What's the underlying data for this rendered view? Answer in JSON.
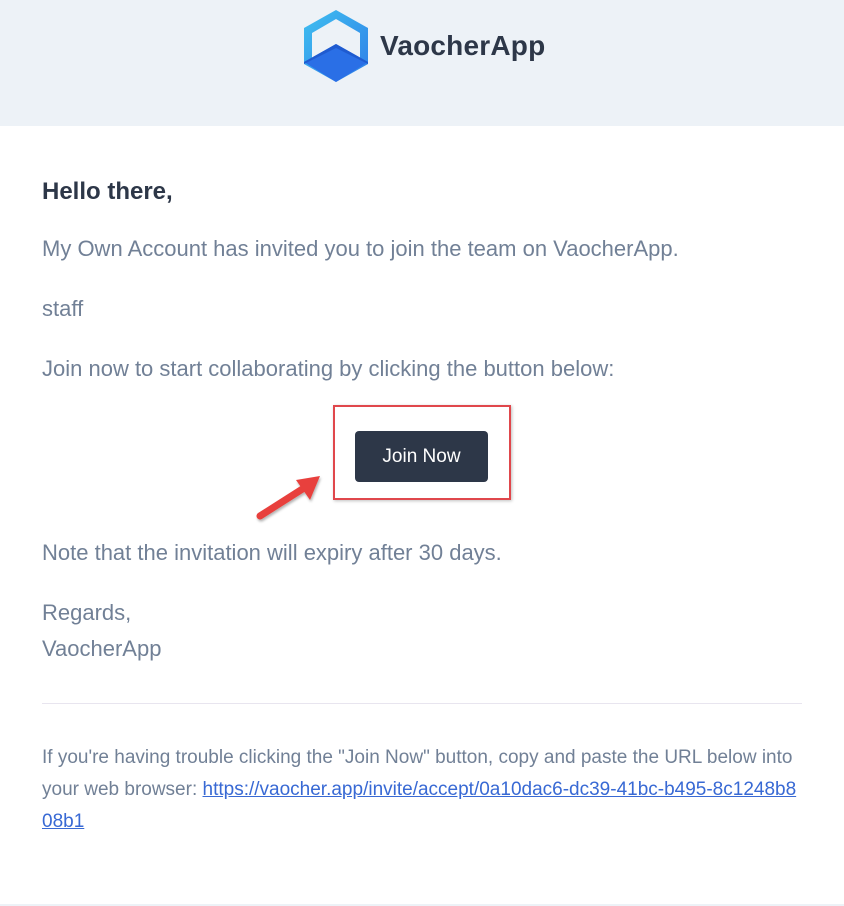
{
  "header": {
    "brand_name": "VaocherApp",
    "logo_icon": "hexagon-cube-icon",
    "background": "#edf2f7"
  },
  "email": {
    "greeting": "Hello there,",
    "invite_line": "My Own Account has invited you to join the team on VaocherApp.",
    "role": "staff",
    "cta_line": "Join now to start collaborating by clicking the button below:",
    "button_label": "Join Now",
    "expiry_note": "Note that the invitation will expiry after 30 days.",
    "regards": "Regards,",
    "signature": "VaocherApp"
  },
  "footer": {
    "trouble_text": "If you're having trouble clicking the \"Join Now\" button, copy and paste the URL below into your web browser: ",
    "url": "https://vaocher.app/invite/accept/0a10dac6-dc39-41bc-b495-8c1248b808b1"
  },
  "annotation": {
    "highlight_color": "#e0474c",
    "arrow_icon": "red-arrow-icon"
  },
  "colors": {
    "button_bg": "#2d3748",
    "text": "#718096",
    "heading": "#2d3748",
    "link": "#3869d4"
  }
}
